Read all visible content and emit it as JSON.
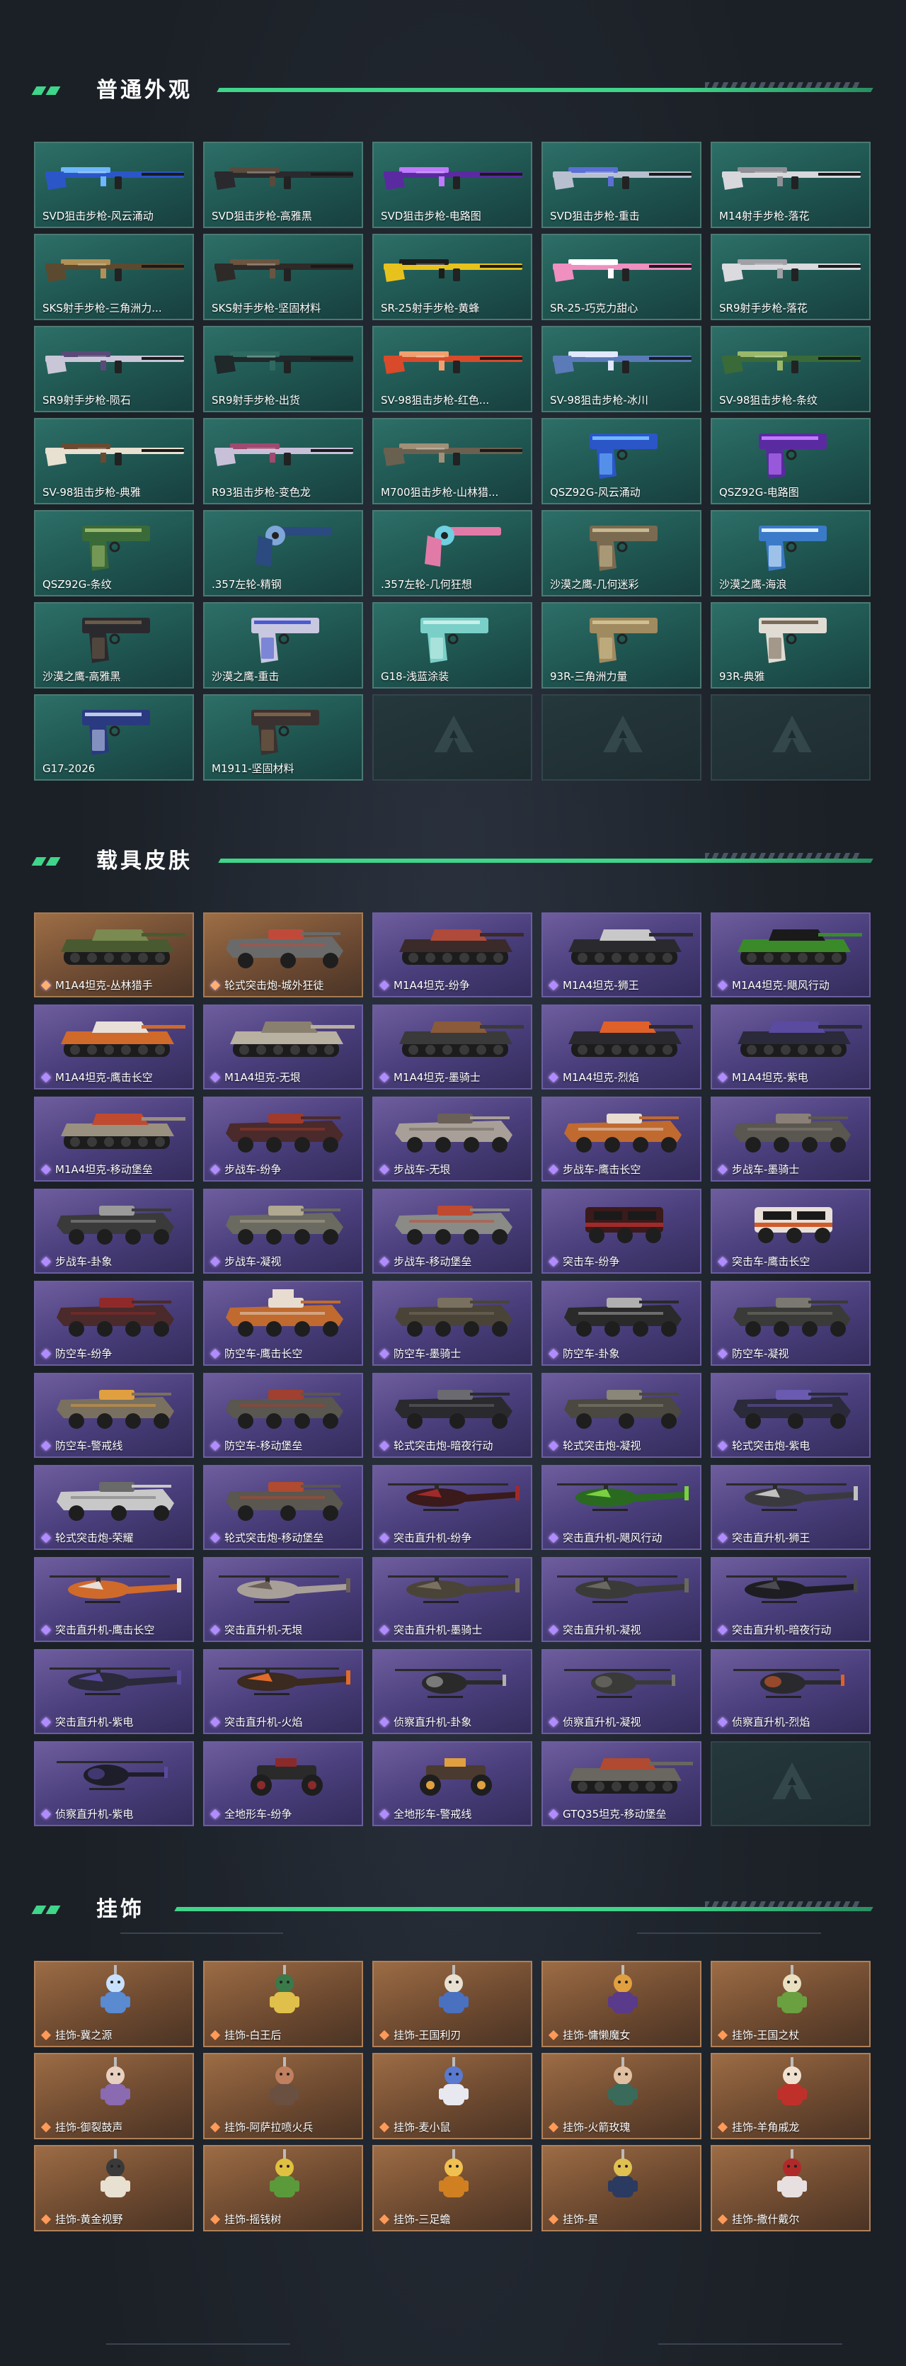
{
  "sections": {
    "weapons": {
      "title": "普通外观",
      "items": [
        {
          "label": "SVD狙击步枪-风云涌动",
          "art": "rifle",
          "c1": "#2b56c8",
          "c2": "#6fb7ff"
        },
        {
          "label": "SVD狙击步枪-高雅黑",
          "art": "rifle",
          "c1": "#2a2a2e",
          "c2": "#5a4a3c"
        },
        {
          "label": "SVD狙击步枪-电路图",
          "art": "rifle",
          "c1": "#5a2aa0",
          "c2": "#c079ff"
        },
        {
          "label": "SVD狙击步枪-重击",
          "art": "rifle",
          "c1": "#b8c0d0",
          "c2": "#5b6fd6"
        },
        {
          "label": "M14射手步枪-落花",
          "art": "rifle",
          "c1": "#d8d8dc",
          "c2": "#8f8f96"
        },
        {
          "label": "SKS射手步枪-三角洲力...",
          "art": "rifle",
          "c1": "#5b4a30",
          "c2": "#b09055"
        },
        {
          "label": "SKS射手步枪-坚固材料",
          "art": "rifle",
          "c1": "#2e2a28",
          "c2": "#6b5540"
        },
        {
          "label": "SR-25射手步枪-黄蜂",
          "art": "rifle",
          "c1": "#e8c21c",
          "c2": "#1c1c1c"
        },
        {
          "label": "SR-25-巧克力甜心",
          "art": "rifle",
          "c1": "#f08fc0",
          "c2": "#ffffff"
        },
        {
          "label": "SR9射手步枪-落花",
          "art": "rifle",
          "c1": "#dadadf",
          "c2": "#a0a0a6"
        },
        {
          "label": "SR9射手步枪-陨石",
          "art": "rifle",
          "c1": "#c9c6d8",
          "c2": "#5a4a78"
        },
        {
          "label": "SR9射手步枪-出货",
          "art": "rifle",
          "c1": "#20282a",
          "c2": "#2f6a60"
        },
        {
          "label": "SV-98狙击步枪-红色...",
          "art": "rifle",
          "c1": "#d84a2a",
          "c2": "#f0a070"
        },
        {
          "label": "SV-98狙击步枪-冰川",
          "art": "rifle",
          "c1": "#5a7ab8",
          "c2": "#dfe8ff"
        },
        {
          "label": "SV-98狙击步枪-条纹",
          "art": "rifle",
          "c1": "#3a6a38",
          "c2": "#9ab86a"
        },
        {
          "label": "SV-98狙击步枪-典雅",
          "art": "rifle",
          "c1": "#e8e0d0",
          "c2": "#6a4a30"
        },
        {
          "label": "R93狙击步枪-变色龙",
          "art": "rifle",
          "c1": "#c8c0d8",
          "c2": "#a04a70"
        },
        {
          "label": "M700狙击步枪-山林猎...",
          "art": "rifle",
          "c1": "#6a6050",
          "c2": "#a09078"
        },
        {
          "label": "QSZ92G-风云涌动",
          "art": "pistol",
          "c1": "#2b56c8",
          "c2": "#6fb7ff"
        },
        {
          "label": "QSZ92G-电路图",
          "art": "pistol",
          "c1": "#5a2aa0",
          "c2": "#c079ff"
        },
        {
          "label": "QSZ92G-条纹",
          "art": "pistol",
          "c1": "#3a6a38",
          "c2": "#9ab86a"
        },
        {
          "label": ".357左轮-精钢",
          "art": "revolver",
          "c1": "#2a4a80",
          "c2": "#7fa6d8"
        },
        {
          "label": ".357左轮-几何狂想",
          "art": "revolver",
          "c1": "#e27aa8",
          "c2": "#6fd0e0"
        },
        {
          "label": "沙漠之鹰-几何迷彩",
          "art": "pistol",
          "c1": "#7a6a50",
          "c2": "#c8b890"
        },
        {
          "label": "沙漠之鹰-海浪",
          "art": "pistol",
          "c1": "#3a7ac8",
          "c2": "#e0f0ff"
        },
        {
          "label": "沙漠之鹰-高雅黑",
          "art": "pistol",
          "c1": "#2a2a2e",
          "c2": "#6a5a48"
        },
        {
          "label": "沙漠之鹰-重击",
          "art": "pistol",
          "c1": "#c8c8e0",
          "c2": "#4a5ad0"
        },
        {
          "label": "G18-浅蓝涂装",
          "art": "pistol",
          "c1": "#7ad0c8",
          "c2": "#c8eee8"
        },
        {
          "label": "93R-三角洲力量",
          "art": "pistol",
          "c1": "#a08a60",
          "c2": "#d0c090"
        },
        {
          "label": "93R-典雅",
          "art": "pistol",
          "c1": "#e0dcd4",
          "c2": "#7a6a58"
        },
        {
          "label": "G17-2026",
          "art": "pistol",
          "c1": "#2a3a80",
          "c2": "#c0c8e8"
        },
        {
          "label": "M1911-坚固材料",
          "art": "pistol",
          "c1": "#3a3230",
          "c2": "#7a6048"
        },
        {
          "label": "",
          "art": "empty"
        },
        {
          "label": "",
          "art": "empty"
        },
        {
          "label": "",
          "art": "empty"
        }
      ]
    },
    "vehicles": {
      "title": "载具皮肤",
      "items": [
        {
          "label": "M1A4坦克-丛林猎手",
          "art": "tank",
          "tier": "gold",
          "c1": "#4a5a30",
          "c2": "#7a8a50"
        },
        {
          "label": "轮式突击炮-城外狂徒",
          "art": "apc",
          "tier": "gold",
          "c1": "#6a6a6a",
          "c2": "#c04a3a"
        },
        {
          "label": "M1A4坦克-纷争",
          "art": "tank",
          "tier": "purple",
          "c1": "#3a2a2a",
          "c2": "#b04a3a"
        },
        {
          "label": "M1A4坦克-狮王",
          "art": "tank",
          "tier": "purple",
          "c1": "#2a2a2e",
          "c2": "#c8c8c8"
        },
        {
          "label": "M1A4坦克-飓风行动",
          "art": "tank",
          "tier": "purple",
          "c1": "#3a8a2a",
          "c2": "#1a1a1a"
        },
        {
          "label": "M1A4坦克-鹰击长空",
          "art": "tank",
          "tier": "purple",
          "c1": "#d06a2a",
          "c2": "#e8e0d8"
        },
        {
          "label": "M1A4坦克-无垠",
          "art": "tank",
          "tier": "purple",
          "c1": "#b8b0a0",
          "c2": "#8a8070"
        },
        {
          "label": "M1A4坦克-墨骑士",
          "art": "tank",
          "tier": "purple",
          "c1": "#3a3a3a",
          "c2": "#8a5a3a"
        },
        {
          "label": "M1A4坦克-烈焰",
          "art": "tank",
          "tier": "purple",
          "c1": "#2a2a2e",
          "c2": "#e0602a"
        },
        {
          "label": "M1A4坦克-紫电",
          "art": "tank",
          "tier": "purple",
          "c1": "#2a2a3a",
          "c2": "#5a4aa0"
        },
        {
          "label": "M1A4坦克-移动堡垒",
          "art": "tank",
          "tier": "purple",
          "c1": "#9a9080",
          "c2": "#c04a30"
        },
        {
          "label": "步战车-纷争",
          "art": "ifv",
          "tier": "purple",
          "c1": "#4a2a2a",
          "c2": "#a03a2a"
        },
        {
          "label": "步战车-无垠",
          "art": "ifv",
          "tier": "purple",
          "c1": "#a8a098",
          "c2": "#6a6058"
        },
        {
          "label": "步战车-鹰击长空",
          "art": "ifv",
          "tier": "purple",
          "c1": "#c06a30",
          "c2": "#e8dcd0"
        },
        {
          "label": "步战车-墨骑士",
          "art": "ifv",
          "tier": "purple",
          "c1": "#5a5650",
          "c2": "#8a8078"
        },
        {
          "label": "步战车-卦象",
          "art": "ifv",
          "tier": "purple",
          "c1": "#3a3a3a",
          "c2": "#9a9a9a"
        },
        {
          "label": "步战车-凝视",
          "art": "ifv",
          "tier": "purple",
          "c1": "#6a6a60",
          "c2": "#b0a890"
        },
        {
          "label": "步战车-移动堡垒",
          "art": "ifv",
          "tier": "purple",
          "c1": "#8a8a86",
          "c2": "#c04a30"
        },
        {
          "label": "突击车-纷争",
          "art": "truck",
          "tier": "purple",
          "c1": "#3a1a1a",
          "c2": "#a02a2a"
        },
        {
          "label": "突击车-鹰击长空",
          "art": "truck",
          "tier": "purple",
          "c1": "#e8e0d8",
          "c2": "#d05a2a"
        },
        {
          "label": "防空车-纷争",
          "art": "ifv",
          "tier": "purple",
          "c1": "#4a2a2a",
          "c2": "#902a2a"
        },
        {
          "label": "防空车-鹰击长空",
          "art": "aa",
          "tier": "purple",
          "c1": "#c06a30",
          "c2": "#e8dcd0"
        },
        {
          "label": "防空车-墨骑士",
          "art": "ifv",
          "tier": "purple",
          "c1": "#4a4438",
          "c2": "#7a7060"
        },
        {
          "label": "防空车-卦象",
          "art": "ifv",
          "tier": "purple",
          "c1": "#2a2a2a",
          "c2": "#b0b0b0"
        },
        {
          "label": "防空车-凝视",
          "art": "ifv",
          "tier": "purple",
          "c1": "#3a3a38",
          "c2": "#7a7870"
        },
        {
          "label": "防空车-警戒线",
          "art": "ifv",
          "tier": "purple",
          "c1": "#7a7060",
          "c2": "#e0a040"
        },
        {
          "label": "防空车-移动堡垒",
          "art": "ifv",
          "tier": "purple",
          "c1": "#5a5650",
          "c2": "#a04030"
        },
        {
          "label": "轮式突击炮-暗夜行动",
          "art": "apc",
          "tier": "purple",
          "c1": "#2a2a2e",
          "c2": "#6a6a70"
        },
        {
          "label": "轮式突击炮-凝视",
          "art": "apc",
          "tier": "purple",
          "c1": "#4a4840",
          "c2": "#8a8678"
        },
        {
          "label": "轮式突击炮-紫电",
          "art": "apc",
          "tier": "purple",
          "c1": "#2a2a3a",
          "c2": "#6a5ab0"
        },
        {
          "label": "轮式突击炮-荣耀",
          "art": "apc",
          "tier": "purple",
          "c1": "#c8c8c8",
          "c2": "#6a6a6a"
        },
        {
          "label": "轮式突击炮-移动堡垒",
          "art": "apc",
          "tier": "purple",
          "c1": "#5a5650",
          "c2": "#b04a30"
        },
        {
          "label": "突击直升机-纷争",
          "art": "heli",
          "tier": "purple",
          "c1": "#3a1a1a",
          "c2": "#a02a2a"
        },
        {
          "label": "突击直升机-飓风行动",
          "art": "heli",
          "tier": "purple",
          "c1": "#2a6a20",
          "c2": "#7ad040"
        },
        {
          "label": "突击直升机-狮王",
          "art": "heli",
          "tier": "purple",
          "c1": "#3a3a3e",
          "c2": "#c0c0c0"
        },
        {
          "label": "突击直升机-鹰击长空",
          "art": "heli",
          "tier": "purple",
          "c1": "#d06a2a",
          "c2": "#e8e0d8"
        },
        {
          "label": "突击直升机-无垠",
          "art": "heli",
          "tier": "purple",
          "c1": "#a8a098",
          "c2": "#6a6058"
        },
        {
          "label": "突击直升机-墨骑士",
          "art": "heli",
          "tier": "purple",
          "c1": "#4a4438",
          "c2": "#7a7060"
        },
        {
          "label": "突击直升机-凝视",
          "art": "heli",
          "tier": "purple",
          "c1": "#3a3a38",
          "c2": "#6a6860"
        },
        {
          "label": "突击直升机-暗夜行动",
          "art": "heli",
          "tier": "purple",
          "c1": "#1e1e22",
          "c2": "#4a4a50"
        },
        {
          "label": "突击直升机-紫电",
          "art": "heli",
          "tier": "purple",
          "c1": "#2a2a3a",
          "c2": "#5a4aa0"
        },
        {
          "label": "突击直升机-火焰",
          "art": "heli",
          "tier": "purple",
          "c1": "#3a2a20",
          "c2": "#e06a2a"
        },
        {
          "label": "侦察直升机-卦象",
          "art": "smallheli",
          "tier": "purple",
          "c1": "#2a2a2a",
          "c2": "#b0b0b0"
        },
        {
          "label": "侦察直升机-凝视",
          "art": "smallheli",
          "tier": "purple",
          "c1": "#3a3a38",
          "c2": "#7a7870"
        },
        {
          "label": "侦察直升机-烈焰",
          "art": "smallheli",
          "tier": "purple",
          "c1": "#2a2a2e",
          "c2": "#e0602a"
        },
        {
          "label": "侦察直升机-紫电",
          "art": "smallheli",
          "tier": "purple",
          "c1": "#1e1e2a",
          "c2": "#5a4aa0"
        },
        {
          "label": "全地形车-纷争",
          "art": "atv",
          "tier": "purple",
          "c1": "#2a2a2a",
          "c2": "#8a2a2a"
        },
        {
          "label": "全地形车-警戒线",
          "art": "atv",
          "tier": "purple",
          "c1": "#4a3a30",
          "c2": "#e0a040"
        },
        {
          "label": "GTQ35坦克-移动堡垒",
          "art": "tank",
          "tier": "purple",
          "c1": "#6a6660",
          "c2": "#b04a30"
        },
        {
          "label": "",
          "art": "empty",
          "tier": "empty"
        }
      ]
    },
    "charms": {
      "title": "挂饰",
      "items": [
        {
          "label": "挂饰-冀之源",
          "art": "charm",
          "c1": "#5a8ad0",
          "c2": "#c8e0ff"
        },
        {
          "label": "挂饰-白王后",
          "art": "charm",
          "c1": "#e0c04a",
          "c2": "#3a7a4a"
        },
        {
          "label": "挂饰-王国利刃",
          "art": "charm",
          "c1": "#4a70c0",
          "c2": "#e8e0d0"
        },
        {
          "label": "挂饰-慵懒魔女",
          "art": "charm",
          "c1": "#5a3a8a",
          "c2": "#e0a040"
        },
        {
          "label": "挂饰-王国之杖",
          "art": "charm",
          "c1": "#6aa040",
          "c2": "#e8e0c0"
        },
        {
          "label": "挂饰-御裂鼓声",
          "art": "charm",
          "c1": "#8a6ab0",
          "c2": "#e8d0c0"
        },
        {
          "label": "挂饰-阿萨拉喷火兵",
          "art": "charm",
          "c1": "#6a5040",
          "c2": "#c08060"
        },
        {
          "label": "挂饰-麦小鼠",
          "art": "charm",
          "c1": "#e8e8f0",
          "c2": "#5a7ad0"
        },
        {
          "label": "挂饰-火箭玫瑰",
          "art": "charm",
          "c1": "#3a6a5a",
          "c2": "#e0c0a0"
        },
        {
          "label": "挂饰-羊角戚龙",
          "art": "charm",
          "c1": "#c0302a",
          "c2": "#f0e0d0"
        },
        {
          "label": "挂饰-黄金视野",
          "art": "charm",
          "c1": "#e8e0d0",
          "c2": "#3a3a3a"
        },
        {
          "label": "挂饰-摇钱树",
          "art": "charm",
          "c1": "#5a9a3a",
          "c2": "#e0c040"
        },
        {
          "label": "挂饰-三足蟾",
          "art": "charm",
          "c1": "#d08020",
          "c2": "#f0c050"
        },
        {
          "label": "挂饰-星",
          "art": "charm",
          "c1": "#2a3a60",
          "c2": "#e0c050"
        },
        {
          "label": "挂饰-撒什戴尔",
          "art": "charm",
          "c1": "#e8e0e0",
          "c2": "#b02a2a"
        }
      ]
    }
  },
  "colors": {
    "accent": "#3fd58a",
    "background": "#1b2026"
  }
}
